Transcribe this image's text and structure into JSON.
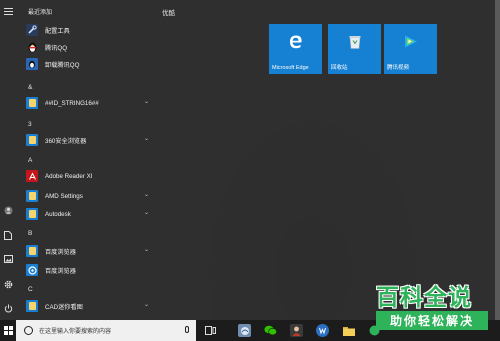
{
  "start_menu": {
    "recent_section_title": "最近添加",
    "tiles_section_title": "优酷",
    "recent_apps": [
      {
        "label": "配置工具",
        "icon": "tool-icon"
      },
      {
        "label": "腾讯QQ",
        "icon": "qq-penguin-icon"
      },
      {
        "label": "卸载腾讯QQ",
        "icon": "qq-uninstall-icon"
      }
    ],
    "groups": [
      {
        "letter": "&",
        "items": [
          {
            "label": "##ID_STRING16##",
            "icon": "folder-icon",
            "expandable": true
          }
        ]
      },
      {
        "letter": "3",
        "items": [
          {
            "label": "360安全浏览器",
            "icon": "folder-icon",
            "expandable": true
          }
        ]
      },
      {
        "letter": "A",
        "items": [
          {
            "label": "Adobe Reader XI",
            "icon": "adobe-reader-icon",
            "expandable": false
          },
          {
            "label": "AMD Settings",
            "icon": "folder-icon",
            "expandable": true
          },
          {
            "label": "Autodesk",
            "icon": "folder-icon",
            "expandable": true
          }
        ]
      },
      {
        "letter": "B",
        "items": [
          {
            "label": "百度浏览器",
            "icon": "folder-icon",
            "expandable": true
          },
          {
            "label": "百度浏览器",
            "icon": "baidu-browser-icon",
            "expandable": false
          }
        ]
      },
      {
        "letter": "C",
        "items": [
          {
            "label": "CAD迷你看图",
            "icon": "folder-icon",
            "expandable": true
          }
        ]
      }
    ]
  },
  "tiles": [
    {
      "label": "Microsoft Edge",
      "icon": "edge-icon"
    },
    {
      "label": "回收站",
      "icon": "recycle-bin-icon"
    },
    {
      "label": "腾讯视频",
      "icon": "tencent-video-icon"
    }
  ],
  "taskbar": {
    "search_placeholder": "在这里输入你要搜索的内容"
  },
  "watermark": {
    "title": "百科全说",
    "subtitle": "助你轻松解决"
  },
  "colors": {
    "tile_blue": "#1681d3",
    "watermark_green": "#2fb35a"
  }
}
